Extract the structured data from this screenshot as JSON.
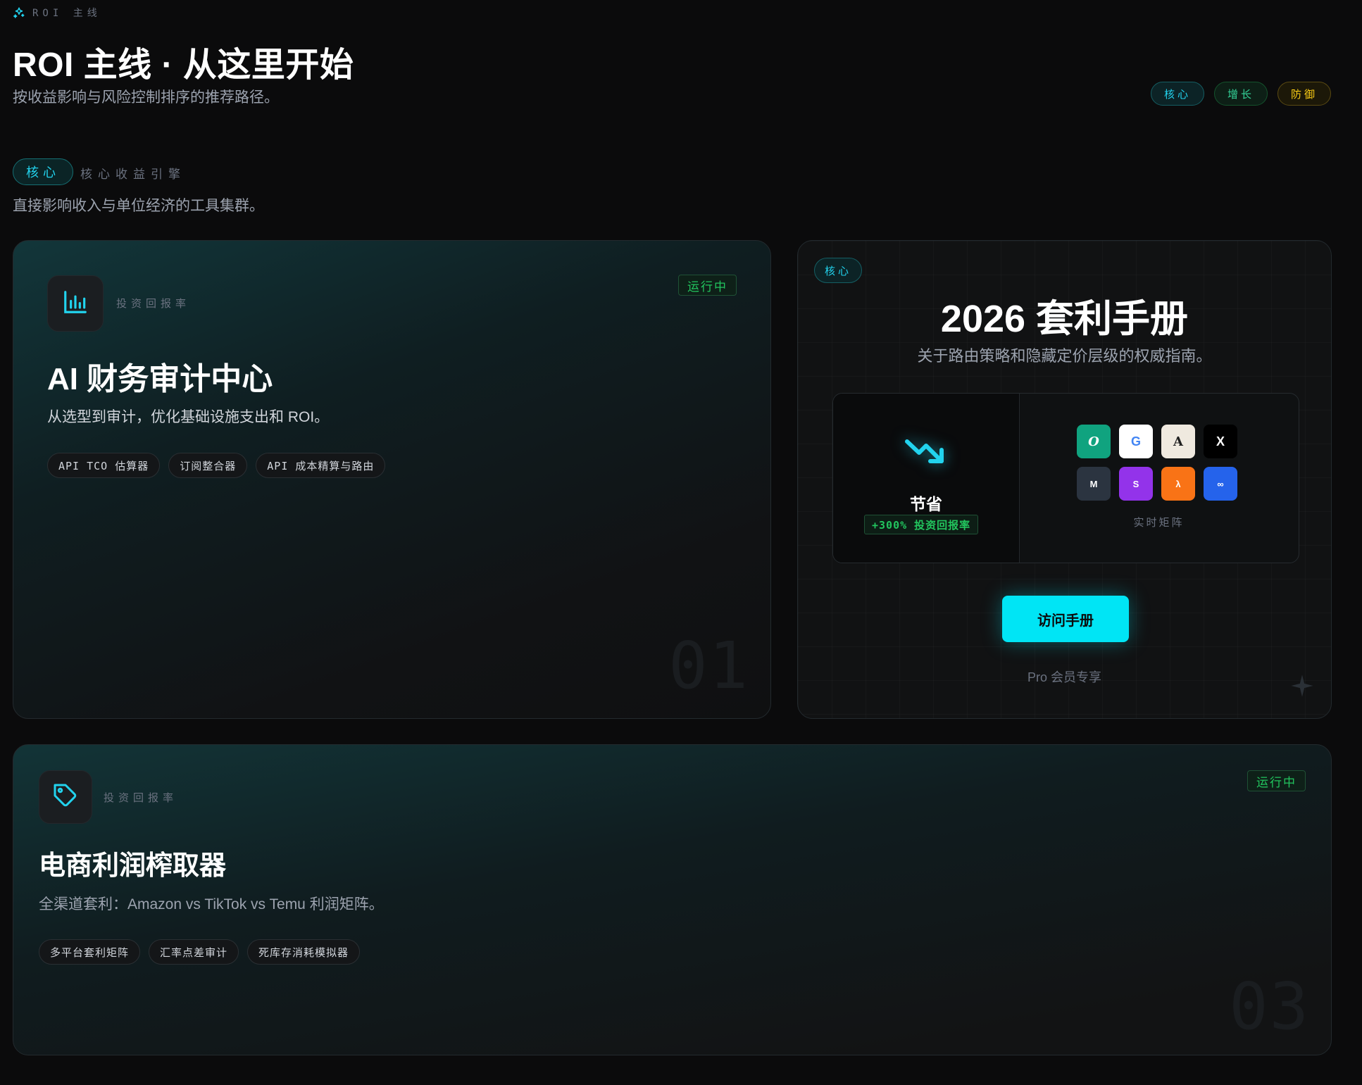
{
  "header": {
    "kicker": "ROI 主线",
    "title": "ROI 主线 · 从这里开始",
    "subtitle": "按收益影响与风险控制排序的推荐路径。",
    "legend": [
      "核心",
      "增长",
      "防御"
    ]
  },
  "section": {
    "chip": "核心",
    "label": "核心收益引擎",
    "description": "直接影响收入与单位经济的工具集群。"
  },
  "cards": [
    {
      "kicker": "投资回报率",
      "status": "运行中",
      "title": "AI 财务审计中心",
      "description": "从选型到审计，优化基础设施支出和 ROI。",
      "tags": [
        "API TCO 估算器",
        "订阅整合器",
        "API 成本精算与路由"
      ],
      "number": "01",
      "icon": "bar-chart-icon"
    },
    {
      "kicker": "投资回报率",
      "status": "运行中",
      "title": "电商利润榨取器",
      "description": "全渠道套利：Amazon vs TikTok vs Temu 利润矩阵。",
      "tags": [
        "多平台套利矩阵",
        "汇率点差审计",
        "死库存消耗模拟器"
      ],
      "number": "03",
      "icon": "tag-icon"
    }
  ],
  "featured": {
    "chip": "核心",
    "title": "2026 套利手册",
    "subtitle": "关于路由策略和隐藏定价层级的权威指南。",
    "save_label": "节省",
    "roi_badge": "+300% 投资回报率",
    "matrix_label": "实时矩阵",
    "providers": [
      {
        "label": "O",
        "bg": "#10a37f",
        "fg": "#ffffff"
      },
      {
        "label": "G",
        "bg": "#ffffff",
        "fg": "#4285f4"
      },
      {
        "label": "A",
        "bg": "#efe9df",
        "fg": "#1f1f1f"
      },
      {
        "label": "X",
        "bg": "#000000",
        "fg": "#ffffff"
      },
      {
        "label": "M",
        "bg": "#2b3440",
        "fg": "#ffffff"
      },
      {
        "label": "S",
        "bg": "#9333ea",
        "fg": "#ffffff"
      },
      {
        "label": "λ",
        "bg": "#f97316",
        "fg": "#ffffff"
      },
      {
        "label": "∞",
        "bg": "#2563eb",
        "fg": "#ffffff"
      }
    ],
    "cta": "访问手册",
    "footnote": "Pro 会员专享"
  },
  "colors": {
    "accent": "#00e5f5",
    "running": "#22c55e",
    "core": "#22d3ee",
    "growth": "#34d399",
    "defense": "#facc15"
  }
}
